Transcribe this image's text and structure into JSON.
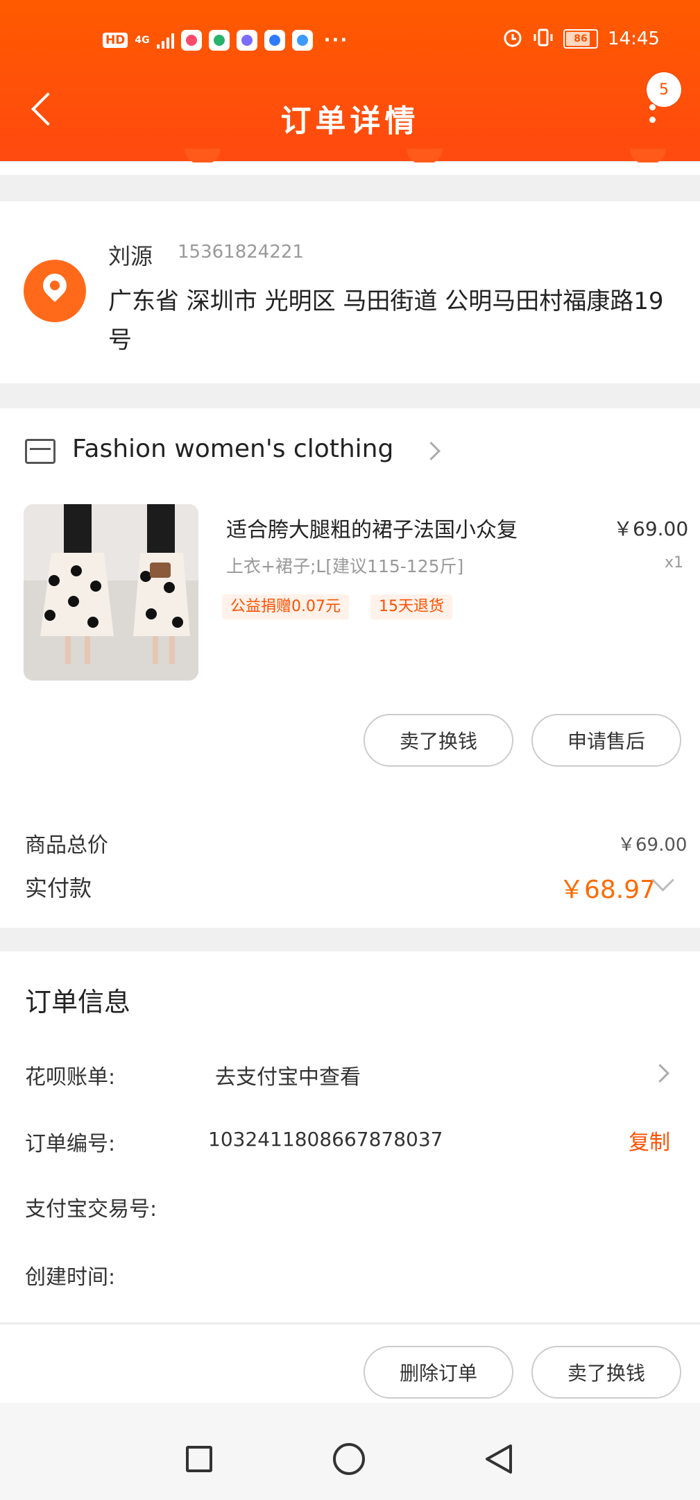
{
  "status_bar": {
    "hd": "HD",
    "network": "4G",
    "battery": "86",
    "time": "14:45",
    "more": "···"
  },
  "header": {
    "title": "订单详情",
    "badge": "5",
    "back_icon": "chevron-left-icon",
    "menu_icon": "more-vertical-icon"
  },
  "address": {
    "name": "刘源",
    "phone": "15361824221",
    "line": "广东省 深圳市 光明区 马田街道 公明马田村福康路19号",
    "icon": "location-pin-icon"
  },
  "store": {
    "name": "Fashion women's clothing",
    "icon": "store-icon"
  },
  "product": {
    "title": "适合胯大腿粗的裙子法国小众复",
    "price": "￥69.00",
    "sku": "上衣+裙子;L[建议115-125斤]",
    "qty": "x1",
    "tags": [
      "公益捐赠0.07元",
      "15天退货"
    ]
  },
  "item_actions": {
    "sell": "卖了换钱",
    "after_sale": "申请售后"
  },
  "totals": {
    "goods_total_label": "商品总价",
    "goods_total_value": "￥69.00",
    "paid_label": "实付款",
    "paid_value": "￥68.97"
  },
  "order_info": {
    "title": "订单信息",
    "huabei_label": "花呗账单:",
    "huabei_value": "去支付宝中查看",
    "order_no_label": "订单编号:",
    "order_no_value": "1032411808667878037",
    "copy": "复制",
    "alipay_label": "支付宝交易号:",
    "created_label": "创建时间:"
  },
  "footer_actions": {
    "delete": "删除订单",
    "sell": "卖了换钱"
  },
  "colors": {
    "brand": "#ff5000",
    "header": "#ff5a00"
  }
}
